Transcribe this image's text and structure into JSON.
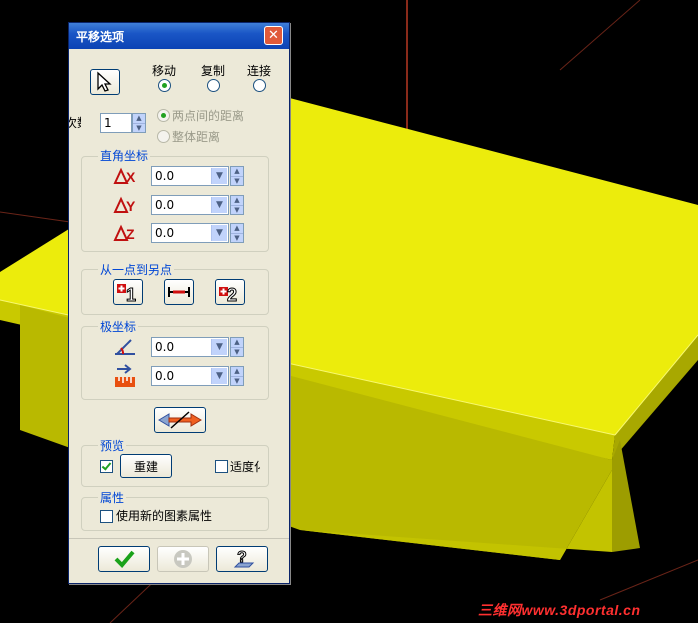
{
  "dialog": {
    "title": "平移选项",
    "close_glyph": "✕",
    "mode_radios": [
      {
        "label": "移动",
        "selected": true
      },
      {
        "label": "复制",
        "selected": false
      },
      {
        "label": "连接",
        "selected": false
      }
    ],
    "count_label": "次数",
    "count_value": "1",
    "distance_options": [
      {
        "label": "两点间的距离",
        "selected": true,
        "disabled": true
      },
      {
        "label": "整体距离",
        "selected": false,
        "disabled": true
      }
    ],
    "rect_coords": {
      "title": "直角坐标",
      "rows": [
        {
          "icon": "delta-x-icon",
          "value": "0.0"
        },
        {
          "icon": "delta-y-icon",
          "value": "0.0"
        },
        {
          "icon": "delta-z-icon",
          "value": "0.0"
        }
      ]
    },
    "point_to_point": {
      "title": "从一点到另点",
      "buttons": [
        "from-point-1-icon",
        "distance-icon",
        "to-point-2-icon"
      ]
    },
    "polar_coords": {
      "title": "极坐标",
      "rows": [
        {
          "icon": "angle-icon",
          "value": "0.0"
        },
        {
          "icon": "length-icon",
          "value": "0.0"
        }
      ]
    },
    "preview": {
      "title": "预览",
      "rebuild_checked": true,
      "rebuild_label": "重建",
      "fit_checked": false,
      "fit_label": "适度化"
    },
    "attributes": {
      "title": "属性",
      "use_new_checked": false,
      "use_new_label": "使用新的图素属性"
    },
    "footer_icons": [
      "ok-check-icon",
      "add-plus-icon",
      "help-icon"
    ]
  },
  "watermark": "三维网www.3dportal.cn",
  "colors": {
    "model_top": "#ecec0c",
    "model_front": "#c9c900",
    "model_side": "#a8a800",
    "axis_line": "#8a2a1a",
    "titlebar": "#0c43b4"
  }
}
